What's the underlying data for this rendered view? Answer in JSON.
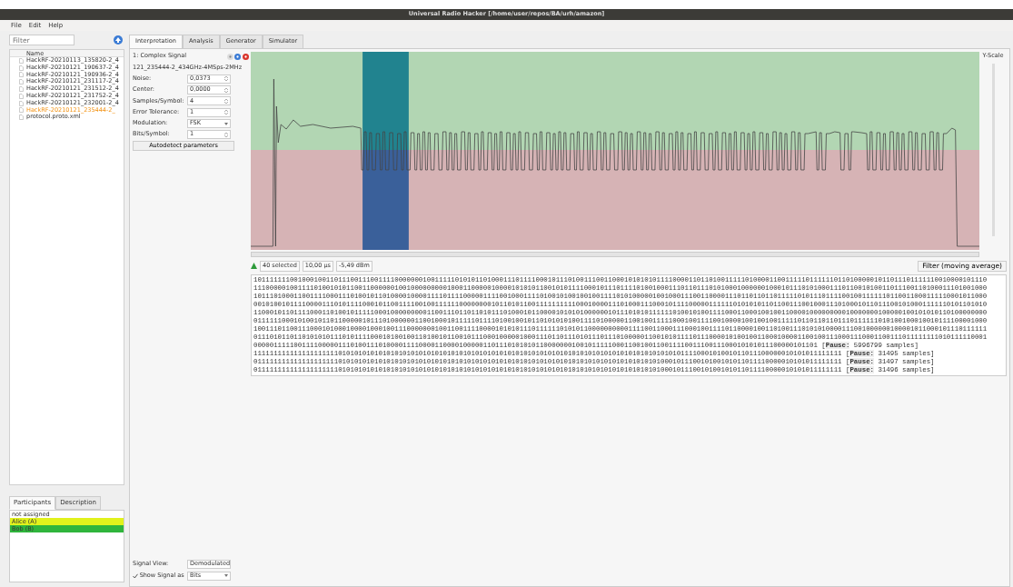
{
  "window": {
    "title": "Universal Radio Hacker [/home/user/repos/BA/urh/amazon]"
  },
  "menu": [
    "File",
    "Edit",
    "Help"
  ],
  "sidebar": {
    "filter": {
      "placeholder": "Filter"
    },
    "tree_header": "Name",
    "files": [
      {
        "name": "HackRF-20210113_135820-2_4",
        "selected": false
      },
      {
        "name": "HackRF-20210121_190637-2_4",
        "selected": false
      },
      {
        "name": "HackRF-20210121_190936-2_4",
        "selected": false
      },
      {
        "name": "HackRF-20210121_231117-2_4",
        "selected": false
      },
      {
        "name": "HackRF-20210121_231512-2_4",
        "selected": false
      },
      {
        "name": "HackRF-20210121_231752-2_4",
        "selected": false
      },
      {
        "name": "HackRF-20210121_232001-2_4",
        "selected": false
      },
      {
        "name": "HackRF-20210121_235444-2_",
        "selected": true
      },
      {
        "name": "protocol.proto.xml",
        "selected": false
      }
    ]
  },
  "participant_tabs": [
    {
      "label": "Participants",
      "selected": true
    },
    {
      "label": "Description",
      "selected": false
    }
  ],
  "participants": [
    {
      "name": "not assigned",
      "color": "#ffffff"
    },
    {
      "name": "Alice (A)",
      "color": "#e1f21c"
    },
    {
      "name": "Bob (B)",
      "color": "#2fb53c"
    }
  ],
  "tabs": [
    {
      "label": "Interpretation",
      "selected": true
    },
    {
      "label": "Analysis",
      "selected": false
    },
    {
      "label": "Generator",
      "selected": false
    },
    {
      "label": "Simulator",
      "selected": false
    }
  ],
  "signal": {
    "title": "1: Complex Signal",
    "file": "121_235444-2_434GHz-4MSps-2MHz",
    "params": [
      {
        "label": "Noise:",
        "value": "0,0373",
        "kind": "spin"
      },
      {
        "label": "Center:",
        "value": "0,0000",
        "kind": "spin"
      },
      {
        "label": "Samples/Symbol:",
        "value": "4",
        "kind": "spin"
      },
      {
        "label": "Error Tolerance:",
        "value": "1",
        "kind": "spin"
      },
      {
        "label": "Modulation:",
        "value": "FSK",
        "kind": "combo"
      },
      {
        "label": "Bits/Symbol:",
        "value": "1",
        "kind": "spin"
      }
    ],
    "autodetect": "Autodetect parameters",
    "signal_view": {
      "label": "Signal View:",
      "value": "Demodulated"
    },
    "show_signal_as": {
      "label": "Show Signal as",
      "value": "Bits",
      "checked": true
    },
    "y_scale": "Y-Scale",
    "status": {
      "selected": "40 selected",
      "duration": "10,00 µs",
      "power": "-5,49 dBm",
      "filter": "Filter (moving average)"
    },
    "bits": [
      "10111111100100010011011100111001111000000010011111010101101000111011110001011101001110011000101010101111000011011010011111010000110011111011111101101000001011011101111110010000101110",
      "11100000100111101001010110011000000100100000000010001100000100001010101100101011110001011101111010010001110110111010100010000001000101110101000111011001010011011100110100011101001000",
      "10111010001100111100011101001011010000100001111011110000011110010001111010010100100100111101010000010010001110011000011101101101101111101011101111001001111110110011000111110001011000",
      "00101001011110000111010111100010110011110010011111100000000101101011001111111111000100001110100011100010111100000111111010101011011001110010001110100010110111001010001111110101101010",
      "11000101101111000110100101111100010000000001100111011011010111010001011000010101010000001011101010111111010010100111100011000100100110000100000000010000000100000100101010110100000000",
      "01111110001010010110110000010111010000001100100010111110111101001001011010101010011110100000110010011111000100111100100001001001001111101101101101110111111010100100010010111100001000",
      "10011101100111000101000100001000100111000000010011001111000010101011101111110101011000000000011110011000111000100111101100001001101001110101010000111001000000100001011000101110111111",
      "01110101101101010101110101111000101001001101001011001011100010000010001110110111010111011101000001100101011110111000010100100110001000011001001110001110001100111011111111010111110001",
      "00000111110011110000011101001110100001111000011000010000011011101010101100000001001011111000110010011001111001110011100010101011100000101101 [**Pause:** 5996799 samples]",
      "11111111111111111111101010101010101010101010101010101010101010101010101010101010101010101010101010101010101111000101001011011100000010101011111111 [**Pause:** 31495 samples]",
      "01111111111111111111101010101010101010101010101010101010101010101010101010101010101010101010101010101000101110010100101011011110000010101011111111 [**Pause:** 31497 samples]",
      "01111111111111111111101010101010101010101010101010101010101010101010101010101010101010101010101010101000101110010100101011011110000010101011111111 [**Pause:** 31496 samples]"
    ]
  }
}
